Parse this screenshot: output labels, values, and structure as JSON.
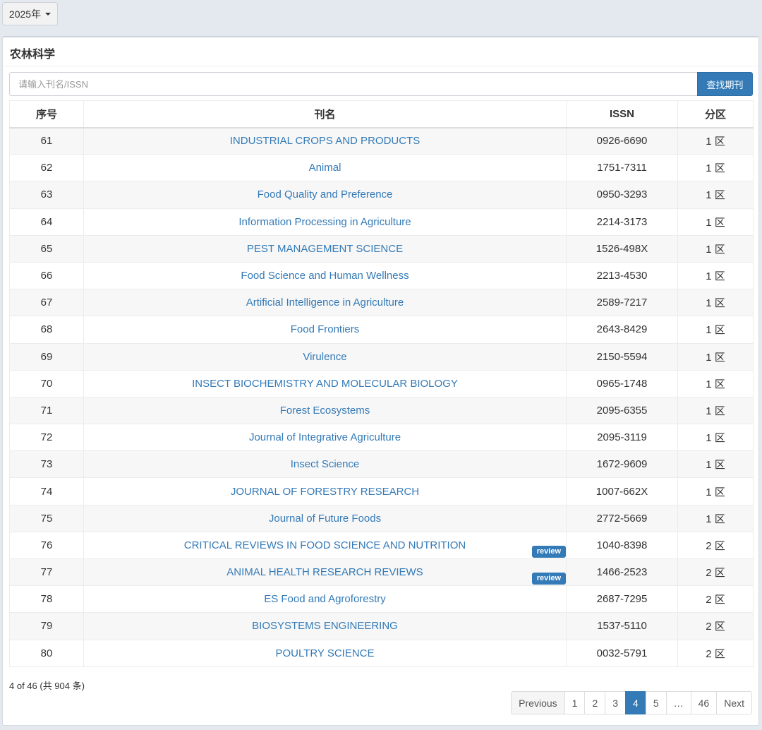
{
  "year_selector": {
    "label": "2025年"
  },
  "panel": {
    "title": "农林科学"
  },
  "search": {
    "placeholder": "请输入刊名/ISSN",
    "button_label": "查找期刊"
  },
  "table": {
    "headers": {
      "index": "序号",
      "name": "刊名",
      "issn": "ISSN",
      "zone": "分区"
    },
    "rows": [
      {
        "index": "61",
        "name": "INDUSTRIAL CROPS AND PRODUCTS",
        "issn": "0926-6690",
        "zone": "1 区",
        "badge": ""
      },
      {
        "index": "62",
        "name": "Animal",
        "issn": "1751-7311",
        "zone": "1 区",
        "badge": ""
      },
      {
        "index": "63",
        "name": "Food Quality and Preference",
        "issn": "0950-3293",
        "zone": "1 区",
        "badge": ""
      },
      {
        "index": "64",
        "name": "Information Processing in Agriculture",
        "issn": "2214-3173",
        "zone": "1 区",
        "badge": ""
      },
      {
        "index": "65",
        "name": "PEST MANAGEMENT SCIENCE",
        "issn": "1526-498X",
        "zone": "1 区",
        "badge": ""
      },
      {
        "index": "66",
        "name": "Food Science and Human Wellness",
        "issn": "2213-4530",
        "zone": "1 区",
        "badge": ""
      },
      {
        "index": "67",
        "name": "Artificial Intelligence in Agriculture",
        "issn": "2589-7217",
        "zone": "1 区",
        "badge": ""
      },
      {
        "index": "68",
        "name": "Food Frontiers",
        "issn": "2643-8429",
        "zone": "1 区",
        "badge": ""
      },
      {
        "index": "69",
        "name": "Virulence",
        "issn": "2150-5594",
        "zone": "1 区",
        "badge": ""
      },
      {
        "index": "70",
        "name": "INSECT BIOCHEMISTRY AND MOLECULAR BIOLOGY",
        "issn": "0965-1748",
        "zone": "1 区",
        "badge": ""
      },
      {
        "index": "71",
        "name": "Forest Ecosystems",
        "issn": "2095-6355",
        "zone": "1 区",
        "badge": ""
      },
      {
        "index": "72",
        "name": "Journal of Integrative Agriculture",
        "issn": "2095-3119",
        "zone": "1 区",
        "badge": ""
      },
      {
        "index": "73",
        "name": "Insect Science",
        "issn": "1672-9609",
        "zone": "1 区",
        "badge": ""
      },
      {
        "index": "74",
        "name": "JOURNAL OF FORESTRY RESEARCH",
        "issn": "1007-662X",
        "zone": "1 区",
        "badge": ""
      },
      {
        "index": "75",
        "name": "Journal of Future Foods",
        "issn": "2772-5669",
        "zone": "1 区",
        "badge": ""
      },
      {
        "index": "76",
        "name": "CRITICAL REVIEWS IN FOOD SCIENCE AND NUTRITION",
        "issn": "1040-8398",
        "zone": "2 区",
        "badge": "review"
      },
      {
        "index": "77",
        "name": "ANIMAL HEALTH RESEARCH REVIEWS",
        "issn": "1466-2523",
        "zone": "2 区",
        "badge": "review"
      },
      {
        "index": "78",
        "name": "ES Food and Agroforestry",
        "issn": "2687-7295",
        "zone": "2 区",
        "badge": ""
      },
      {
        "index": "79",
        "name": "BIOSYSTEMS ENGINEERING",
        "issn": "1537-5110",
        "zone": "2 区",
        "badge": ""
      },
      {
        "index": "80",
        "name": "POULTRY SCIENCE",
        "issn": "0032-5791",
        "zone": "2 区",
        "badge": ""
      }
    ]
  },
  "summary": "4 of 46 (共 904 条)",
  "pagination": {
    "previous": "Previous",
    "pages": [
      "1",
      "2",
      "3",
      "4",
      "5",
      "…",
      "46"
    ],
    "active": "4",
    "next": "Next"
  },
  "colors": {
    "accent": "#337ab7",
    "background": "#e4e8ef",
    "row_stripe": "#f7f7f7"
  }
}
